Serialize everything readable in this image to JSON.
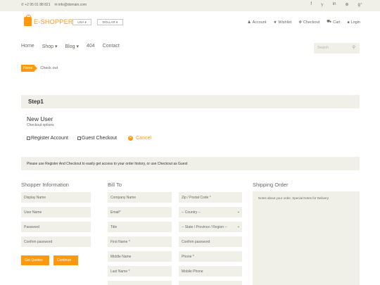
{
  "topbar": {
    "phone": "+2 95 01 88 821",
    "email": "info@domain.com",
    "social_icons": [
      "facebook-icon",
      "twitter-icon",
      "linkedin-icon",
      "dribbble-icon",
      "google-plus-icon"
    ],
    "social_glyphs": [
      "f",
      "𝕪",
      "in",
      "⊕",
      "g⁺"
    ]
  },
  "header": {
    "logo_text": "E-SHOPPER",
    "currency_a": "USA ▾",
    "currency_b": "DOLLAR ▾",
    "account_nav": [
      {
        "icon": "user-icon",
        "glyph": "♟",
        "label": "Account"
      },
      {
        "icon": "star-icon",
        "glyph": "★",
        "label": "Wishlist"
      },
      {
        "icon": "crosshairs-icon",
        "glyph": "✥",
        "label": "Checkout"
      },
      {
        "icon": "cart-icon",
        "glyph": "⛟",
        "label": "Cart"
      },
      {
        "icon": "lock-icon",
        "glyph": "🔒",
        "label": "Login"
      }
    ]
  },
  "menu": {
    "items": [
      "Home",
      "Shop ▾",
      "Blog ▾",
      "404",
      "Contact"
    ],
    "search_placeholder": "Search"
  },
  "breadcrumb": {
    "home": "Home",
    "current": "Check out"
  },
  "step": {
    "title": "Step1",
    "new_user": "New User",
    "checkout_options": "Checkout options",
    "register_label": "Register Account",
    "guest_label": "Guest Checkout",
    "cancel_label": "Cancel"
  },
  "notice": "Please use Register And Checkout to easily get access to your order history, or use Checkout as Guest",
  "shopper": {
    "title": "Shopper Information",
    "display_name": "Display Name",
    "user_name": "User Name",
    "password": "Password",
    "confirm_password": "Confirm password",
    "get_quotes": "Get Quotes",
    "continue": "Continue"
  },
  "bill_to": {
    "title": "Bill To",
    "left": [
      "Company Name",
      "Email*",
      "Title",
      "First Name *",
      "Middle Name",
      "Last Name *"
    ],
    "zip": "Zip / Postal Code *",
    "country": "-- Country --",
    "state": "-- State / Province / Region --",
    "confirm_password": "Confirm password",
    "phone": "Phone *",
    "mobile": "Mobile Phone"
  },
  "shipping": {
    "title": "Shipping Order",
    "notes_placeholder": "Notes about your order, Special Notes for Delivery"
  },
  "colors": {
    "accent": "#fe980f",
    "panel": "#f0f0e9",
    "text": "#696763"
  }
}
